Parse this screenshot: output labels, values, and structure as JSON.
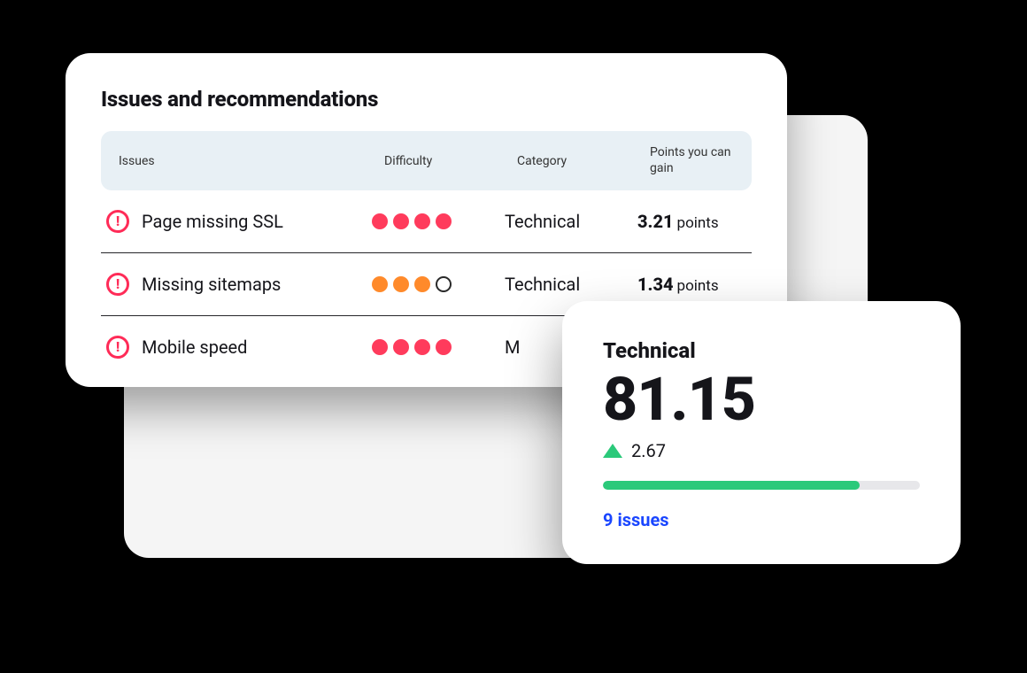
{
  "issues_panel": {
    "title": "Issues and recommendations",
    "columns": {
      "issues": "Issues",
      "difficulty": "Difficulty",
      "category": "Category",
      "points": "Points you can gain"
    },
    "points_unit": "points",
    "rows": [
      {
        "name": "Page missing SSL",
        "difficulty": {
          "filled": 4,
          "total": 4,
          "color": "red"
        },
        "category": "Technical",
        "points": "3.21"
      },
      {
        "name": "Missing sitemaps",
        "difficulty": {
          "filled": 3,
          "total": 4,
          "color": "orange"
        },
        "category": "Technical",
        "points": "1.34"
      },
      {
        "name": "Mobile speed",
        "difficulty": {
          "filled": 4,
          "total": 4,
          "color": "red"
        },
        "category": "M",
        "points": ""
      }
    ]
  },
  "score_card": {
    "label": "Technical",
    "value": "81.15",
    "delta": "2.67",
    "progress_percent": 81,
    "issues_link": "9 issues"
  },
  "colors": {
    "red": "#ff3b5c",
    "orange": "#ff8a2b",
    "green": "#2bc97a",
    "link_blue": "#1a46ff"
  }
}
